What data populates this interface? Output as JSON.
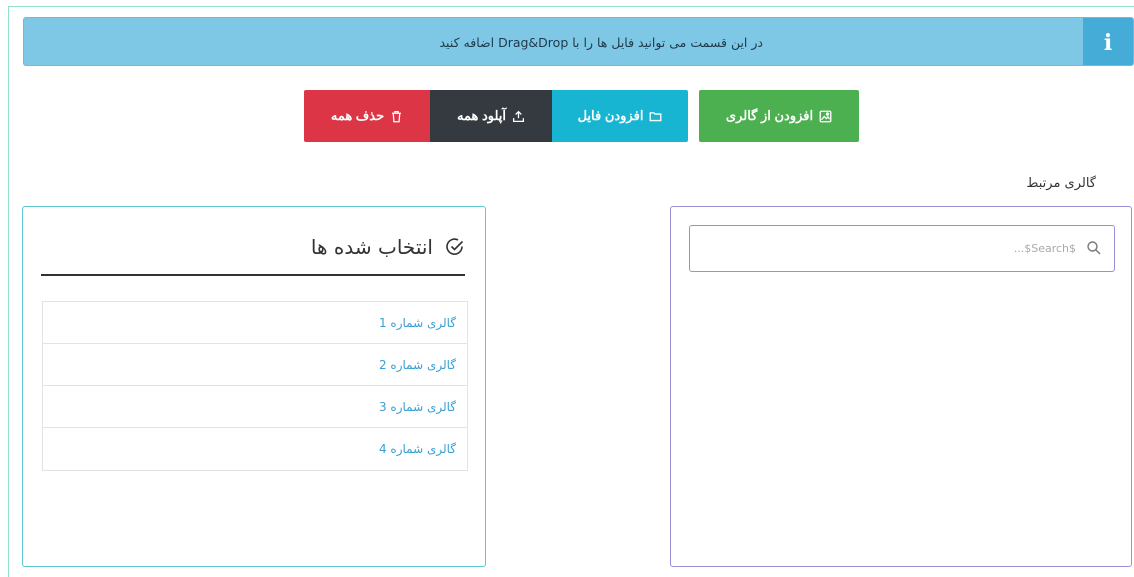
{
  "alert": {
    "icon": "info-icon",
    "icon_glyph": "i",
    "message": "در این قسمت می توانید فایل ها را با Drag&Drop اضافه کنید",
    "color": "#7ec8e6"
  },
  "toolbar": {
    "add_from_gallery": "افزودن از گالری",
    "add_file": "افزودن فایل",
    "upload_all": "آپلود همه",
    "delete_all": "حذف همه",
    "colors": {
      "gallery": "#4caf50",
      "file": "#17b5d2",
      "upload": "#343a40",
      "delete": "#dc3545"
    }
  },
  "related_gallery": {
    "label": "گالری مرتبط",
    "search_placeholder": "...$Search$"
  },
  "selected": {
    "title": "انتخاب شده ها",
    "items": [
      {
        "label": "گالری شماره 1"
      },
      {
        "label": "گالری شماره 2"
      },
      {
        "label": "گالری شماره 3"
      },
      {
        "label": "گالری شماره 4"
      }
    ]
  }
}
